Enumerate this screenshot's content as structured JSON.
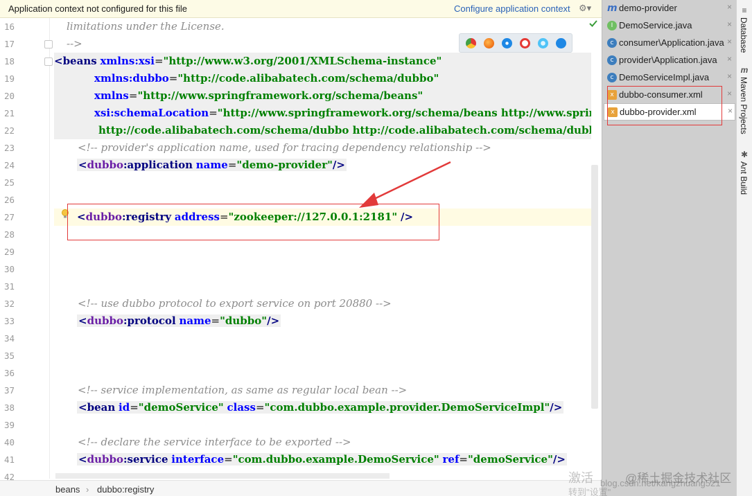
{
  "notification": {
    "message": "Application context not configured for this file",
    "action": "Configure application context",
    "settings_glyph": "⚙▾"
  },
  "line_numbers": [
    "16",
    "17",
    "18",
    "19",
    "20",
    "21",
    "22",
    "23",
    "24",
    "25",
    "26",
    "27",
    "28",
    "29",
    "30",
    "31",
    "32",
    "33",
    "34",
    "35",
    "36",
    "37",
    "38",
    "39",
    "40",
    "41",
    "42"
  ],
  "code": {
    "l16": "limitations under the License.",
    "l17": "-->",
    "l18_tag": "<beans",
    "l18_attr": "xmlns:xsi",
    "l18_val": "\"http://www.w3.org/2001/XMLSchema-instance\"",
    "l19_attr": "xmlns:dubbo",
    "l19_val": "\"http://code.alibabatech.com/schema/dubbo\"",
    "l20_attr": "xmlns",
    "l20_val": "\"http://www.springframework.org/schema/beans\"",
    "l21_attr": "xsi:schemaLocation",
    "l21_val": "\"http://www.springframework.org/schema/beans http://www.spring",
    "l22_val": "http://code.alibabatech.com/schema/dubbo http://code.alibabatech.com/schema/dubb",
    "l23": "<!-- provider's application name, used for tracing dependency relationship -->",
    "l24_ns": "dubbo",
    "l24_tag": "application",
    "l24_attr": "name",
    "l24_val": "\"demo-provider\"",
    "l27_ns": "dubbo",
    "l27_tag": "registry",
    "l27_attr": "address",
    "l27_val": "\"zookeeper://127.0.0.1:2181\"",
    "l32": "<!-- use dubbo protocol to export service on port 20880 -->",
    "l33_ns": "dubbo",
    "l33_tag": "protocol",
    "l33_attr": "name",
    "l33_val": "\"dubbo\"",
    "l37": "<!-- service implementation, as same as regular local bean -->",
    "l38_tag": "bean",
    "l38_attr1": "id",
    "l38_val1": "\"demoService\"",
    "l38_attr2": "class",
    "l38_val2": "\"com.dubbo.example.provider.DemoServiceImpl\"",
    "l40": "<!-- declare the service interface to be exported -->",
    "l41_ns": "dubbo",
    "l41_tag": "service",
    "l41_attr1": "interface",
    "l41_val1": "\"com.dubbo.example.DemoService\"",
    "l41_attr2": "ref",
    "l41_val2": "\"demoService\""
  },
  "breadcrumb": {
    "root": "beans",
    "sep": "›",
    "leaf": "dubbo:registry"
  },
  "tabs": [
    {
      "label": "demo-provider",
      "icon": "module-icon",
      "glyph": "m"
    },
    {
      "label": "DemoService.java",
      "icon": "interface-icon",
      "glyph": "I"
    },
    {
      "label": "consumer\\Application.java",
      "icon": "class-icon",
      "glyph": "c"
    },
    {
      "label": "provider\\Application.java",
      "icon": "class-icon",
      "glyph": "c"
    },
    {
      "label": "DemoServiceImpl.java",
      "icon": "class-icon",
      "glyph": "c"
    },
    {
      "label": "dubbo-consumer.xml",
      "icon": "xml-file-icon",
      "glyph": "x"
    },
    {
      "label": "dubbo-provider.xml",
      "icon": "xml-file-icon",
      "glyph": "x"
    }
  ],
  "tab_close_glyph": "×",
  "tool_windows": [
    {
      "label": "Database",
      "icon": "database-icon",
      "glyph": "≡"
    },
    {
      "label": "Maven Projects",
      "icon": "maven-icon",
      "glyph": "m"
    },
    {
      "label": "Ant Build",
      "icon": "ant-icon",
      "glyph": "✱"
    }
  ],
  "watermark": {
    "line1": "激活",
    "line2": "@稀土掘金技术社区",
    "line3": "blog.csdn.net/kangzhuang521",
    "line4": "转到\"设置\""
  },
  "colors": {
    "highlight_box": "#e23a3a",
    "string": "#008000",
    "tag": "#000080",
    "comment": "#8c8c8c",
    "link": "#2a62b8"
  }
}
